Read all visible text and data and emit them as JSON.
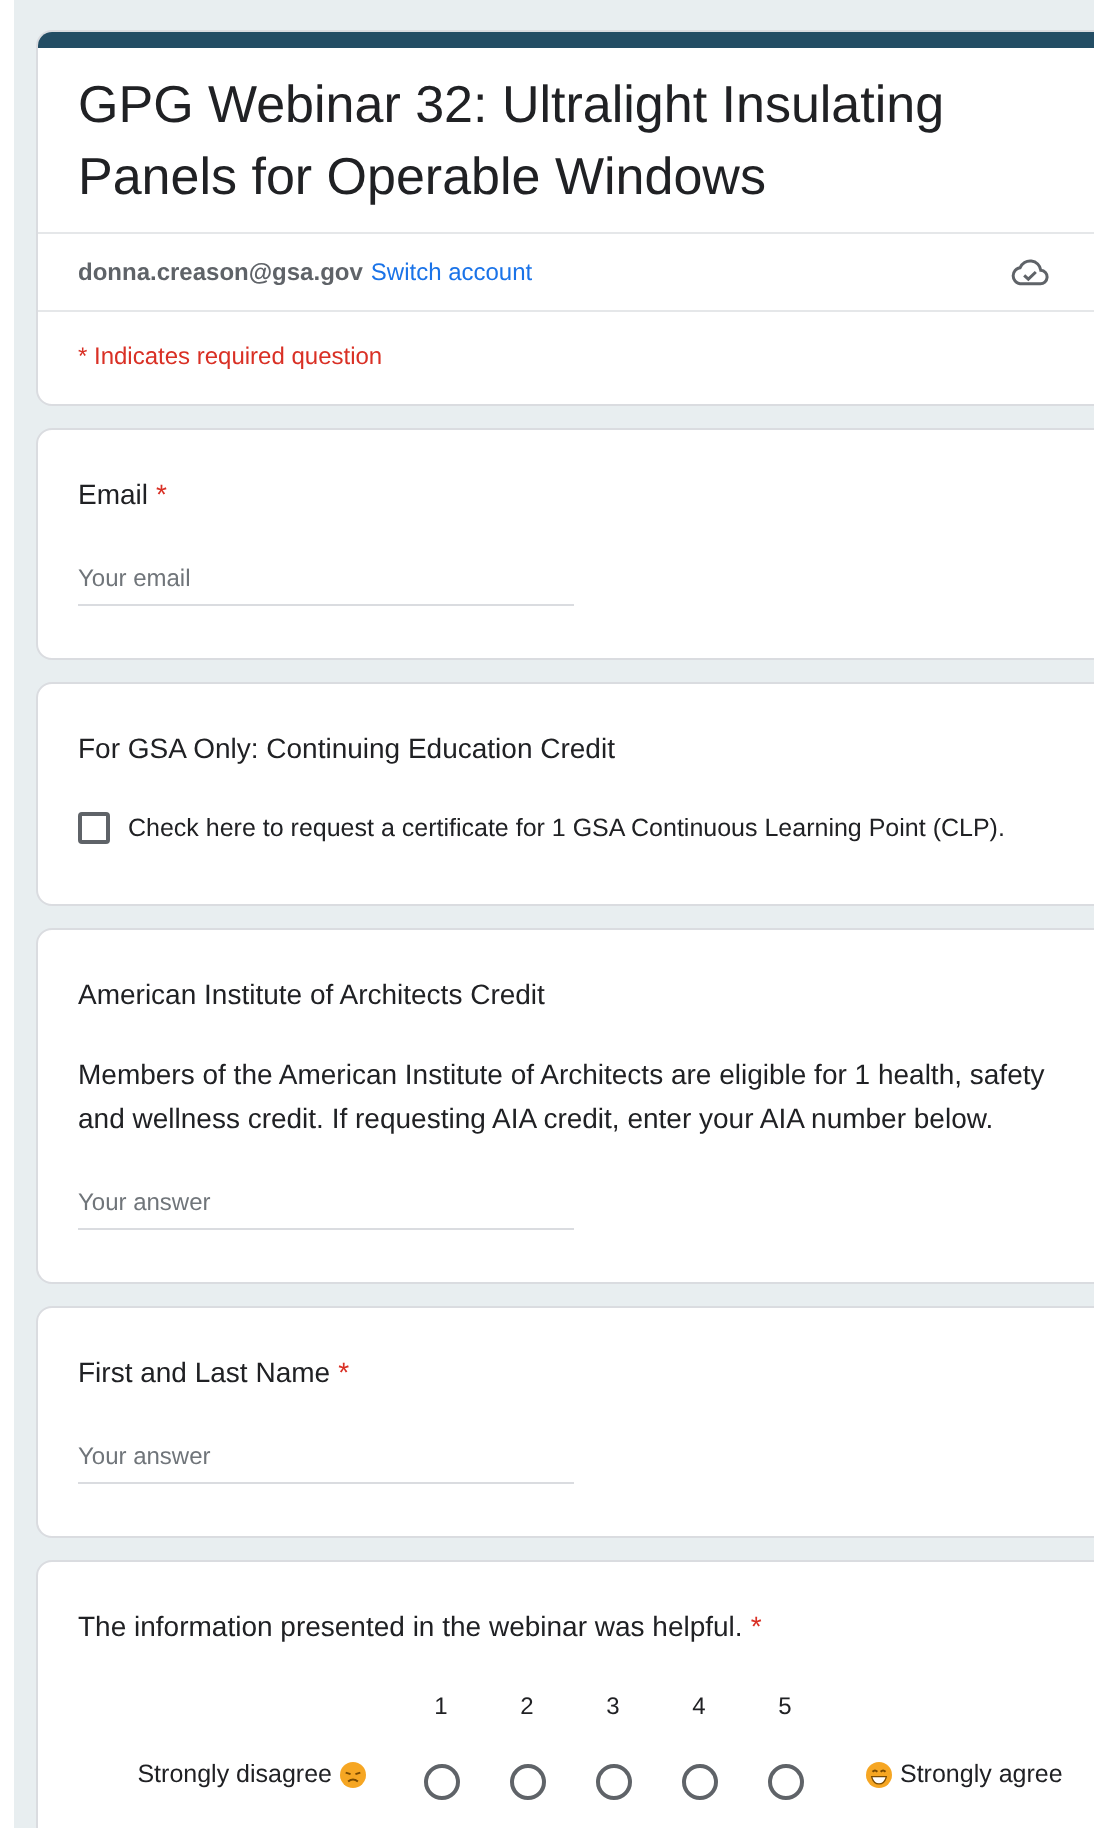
{
  "header": {
    "title": "GPG Webinar 32: Ultralight Insulating Panels for Operable Windows",
    "account_email": "donna.creason@gsa.gov",
    "switch_account": "Switch account",
    "required_note": "* Indicates required question"
  },
  "questions": [
    {
      "kind": "text",
      "title": "Email",
      "required_mark": "*",
      "placeholder": "Your email"
    },
    {
      "kind": "checkbox",
      "title": "For GSA Only: Continuing Education Credit",
      "option": {
        "label": "Check here to request a certificate for 1 GSA Continuous Learning Point (CLP).",
        "checked": false
      }
    },
    {
      "kind": "text",
      "title": "American Institute of Architects Credit",
      "description": "Members of the American Institute of Architects are eligible for 1 health, safety and wellness credit. If requesting AIA credit, enter your AIA number below.",
      "placeholder": "Your answer"
    },
    {
      "kind": "text",
      "title": "First and Last Name",
      "required_mark": "*",
      "placeholder": "Your answer"
    },
    {
      "kind": "scale",
      "title": "The information presented in the webinar was helpful.",
      "required_mark": "*",
      "low_label": "Strongly disagree",
      "high_label": "Strongly agree",
      "points": [
        {
          "label": "1",
          "selected": false
        },
        {
          "label": "2",
          "selected": false
        },
        {
          "label": "3",
          "selected": false
        },
        {
          "label": "4",
          "selected": false
        },
        {
          "label": "5",
          "selected": false
        }
      ]
    }
  ]
}
